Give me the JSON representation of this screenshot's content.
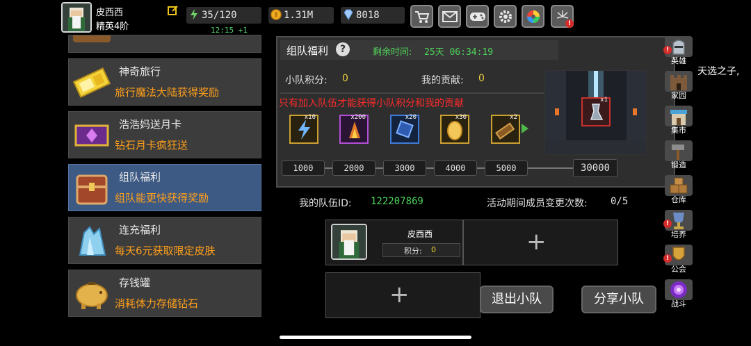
{
  "header": {
    "player_name": "皮西西",
    "player_rank": "精英4阶",
    "energy": "35/120",
    "energy_timer": "12:15 +1",
    "gold": "1.31M",
    "gems": "8018"
  },
  "toolbar": {
    "icons": [
      "cart-icon",
      "mail-icon",
      "gamepad-icon",
      "gear-icon",
      "color-wheel-icon",
      "fireworks-icon"
    ]
  },
  "sidebar_left": {
    "items": [
      {
        "title": "神奇旅行",
        "subtitle": "旅行魔法大陆获得奖励"
      },
      {
        "title": "浩浩妈送月卡",
        "subtitle": "钻石月卡疯狂送"
      },
      {
        "title": "组队福利",
        "subtitle": "组队能更快获得奖励"
      },
      {
        "title": "连充福利",
        "subtitle": "每天6元获取限定皮肤"
      },
      {
        "title": "存钱罐",
        "subtitle": "消耗体力存储钻石"
      }
    ]
  },
  "panel": {
    "title": "组队福利",
    "remaining_label": "剩余时间:",
    "remaining_value": "25天 06:34:19",
    "team_points_label": "小队积分:",
    "team_points_value": "0",
    "my_contrib_label": "我的贡献:",
    "my_contrib_value": "0",
    "warning": "只有加入队伍才能获得小队积分和我的贡献",
    "rewards": [
      {
        "qty": "x10",
        "icon": "lightning-icon"
      },
      {
        "qty": "x200",
        "icon": "fire-crystal-icon"
      },
      {
        "qty": "x20",
        "icon": "blue-gem-icon"
      },
      {
        "qty": "x30",
        "icon": "egg-icon"
      },
      {
        "qty": "x2",
        "icon": "cannon-icon"
      }
    ],
    "milestones": [
      "1000",
      "2000",
      "3000",
      "4000",
      "5000",
      "30000"
    ],
    "grand_reward_qty": "x1"
  },
  "team": {
    "id_label": "我的队伍ID:",
    "id_value": "122207869",
    "changes_label": "活动期间成员变更次数:",
    "changes_value": "0/5",
    "member_name": "皮西西",
    "member_points_label": "积分:",
    "member_points_value": "0",
    "leave_button": "退出小队",
    "share_button": "分享小队"
  },
  "sidebar_right": {
    "items": [
      "英雄",
      "家园",
      "集市",
      "锻造",
      "仓库",
      "培养",
      "公会",
      "战斗"
    ]
  },
  "overflow_text": "天选之子,"
}
